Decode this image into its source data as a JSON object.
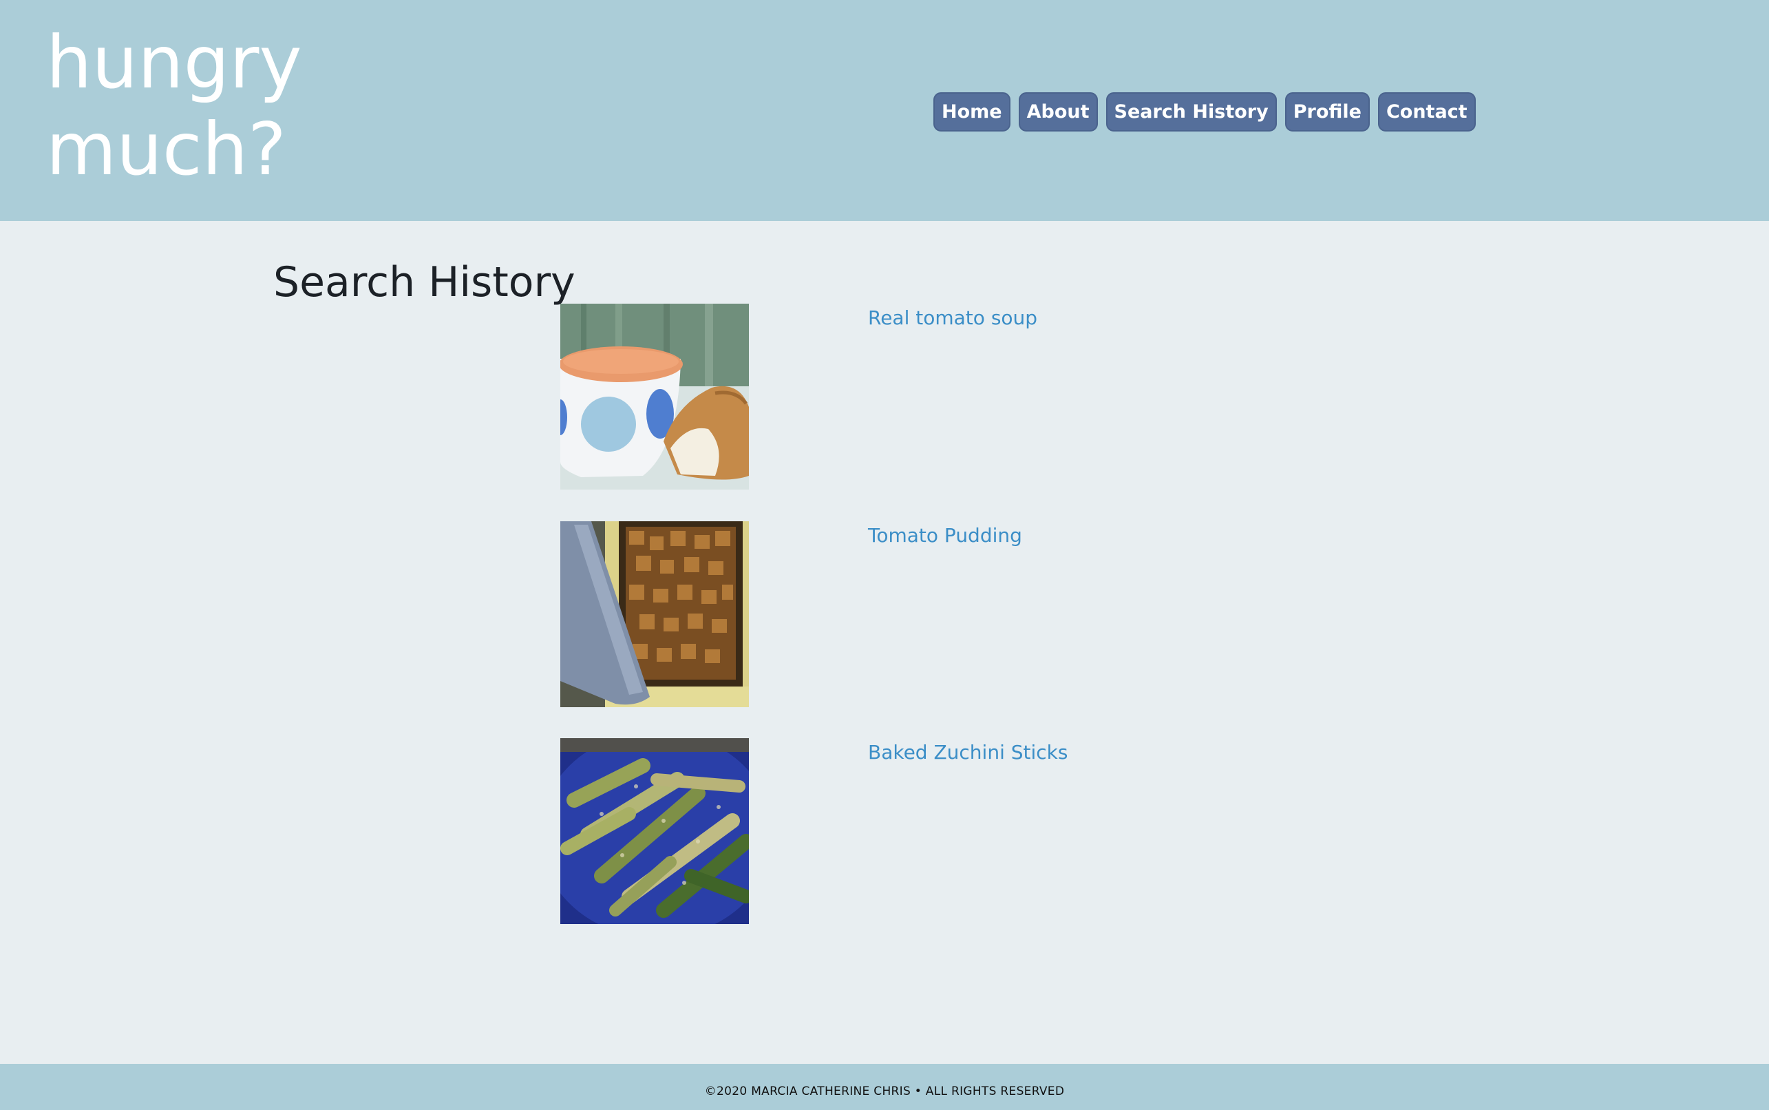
{
  "header": {
    "brand_line1": "hungry",
    "brand_line2": "much?",
    "nav": [
      {
        "label": "Home"
      },
      {
        "label": "About"
      },
      {
        "label": "Search History"
      },
      {
        "label": "Profile"
      },
      {
        "label": "Contact"
      }
    ]
  },
  "main": {
    "title": "Search History",
    "results": [
      {
        "title": "Real tomato soup",
        "image": "tomato-soup-photo"
      },
      {
        "title": "Tomato Pudding",
        "image": "tomato-pudding-photo"
      },
      {
        "title": "Baked Zuchini Sticks",
        "image": "zucchini-sticks-photo"
      }
    ]
  },
  "footer": {
    "text": "©2020 MARCIA CATHERINE CHRIS • ALL RIGHTS RESERVED"
  },
  "colors": {
    "header_bg": "#abcdd8",
    "page_bg": "#e8eef1",
    "nav_button": "#556f9b",
    "link": "#3b8ec7"
  }
}
